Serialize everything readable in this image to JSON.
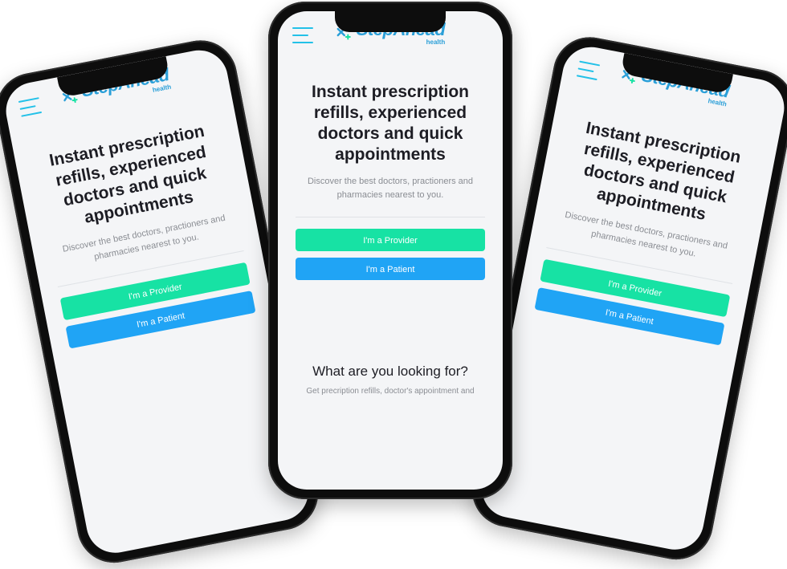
{
  "brand": {
    "name": "StepAhead",
    "sub": "health"
  },
  "hero": {
    "title": "Instant prescription refills, experienced doctors and quick appointments",
    "subtitle": "Discover the best doctors, practioners and pharmacies nearest to you.",
    "provider_label": "I'm a Provider",
    "patient_label": "I'm a Patient"
  },
  "section": {
    "title": "What are you looking for?",
    "text": "Get precription refills, doctor's appointment and"
  },
  "icons": {
    "menu": "menu-icon",
    "logo": "logo-mark-icon"
  },
  "colors": {
    "brand": "#2a9fd8",
    "menu": "#23c1e8",
    "provider_button": "#17e2a4",
    "patient_button": "#20a4f5",
    "screen_bg": "#f4f5f7"
  }
}
